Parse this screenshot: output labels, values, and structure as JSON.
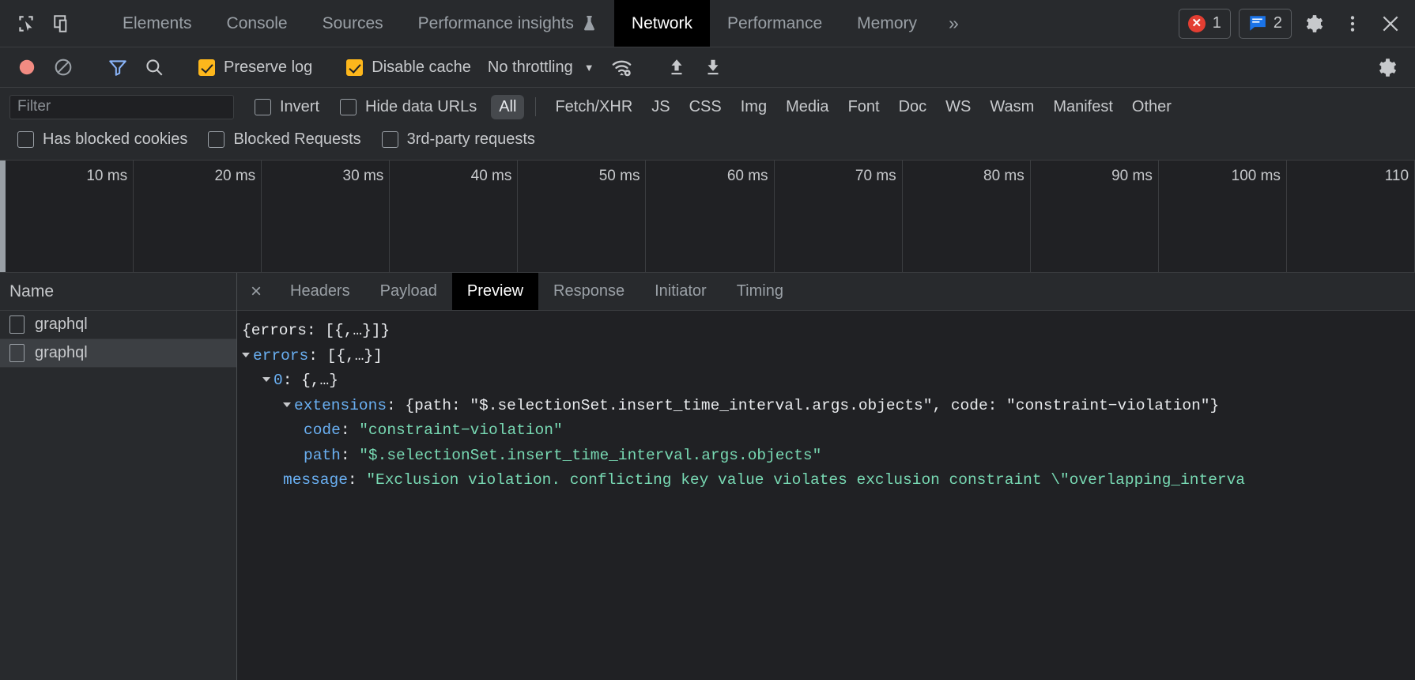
{
  "devtools": {
    "main_tabs": [
      {
        "label": "Elements",
        "selected": false
      },
      {
        "label": "Console",
        "selected": false
      },
      {
        "label": "Sources",
        "selected": false
      },
      {
        "label": "Performance insights",
        "selected": false,
        "icon": "flask-icon"
      },
      {
        "label": "Network",
        "selected": true
      },
      {
        "label": "Performance",
        "selected": false
      },
      {
        "label": "Memory",
        "selected": false
      }
    ],
    "more_tabs_label": "»",
    "error_count": "1",
    "warning_count": "2",
    "icons": {
      "inspect": "inspect-element-icon",
      "device": "device-toolbar-icon",
      "settings": "gear-icon",
      "menu": "kebab-menu-icon",
      "close": "close-icon"
    }
  },
  "network_toolbar": {
    "record_tooltip": "record-button",
    "clear_tooltip": "clear-button",
    "filter_tooltip": "filter-toggle",
    "search_tooltip": "search-button",
    "preserve_log": {
      "label": "Preserve log",
      "checked": true
    },
    "disable_cache": {
      "label": "Disable cache",
      "checked": true
    },
    "throttling": {
      "value": "No throttling",
      "caret": "▼"
    },
    "network_conditions_icon": "wifi-settings-icon",
    "export_icon": "export-har-icon",
    "import_icon": "import-har-icon",
    "settings_icon": "gear-icon"
  },
  "filter_bar": {
    "filter_placeholder": "Filter",
    "filter_value": "",
    "invert": {
      "label": "Invert",
      "checked": false
    },
    "hide_data_urls": {
      "label": "Hide data URLs",
      "checked": false
    },
    "types": [
      {
        "label": "All",
        "active": true
      },
      {
        "label": "Fetch/XHR",
        "active": false
      },
      {
        "label": "JS",
        "active": false
      },
      {
        "label": "CSS",
        "active": false
      },
      {
        "label": "Img",
        "active": false
      },
      {
        "label": "Media",
        "active": false
      },
      {
        "label": "Font",
        "active": false
      },
      {
        "label": "Doc",
        "active": false
      },
      {
        "label": "WS",
        "active": false
      },
      {
        "label": "Wasm",
        "active": false
      },
      {
        "label": "Manifest",
        "active": false
      },
      {
        "label": "Other",
        "active": false
      }
    ],
    "has_blocked_cookies": {
      "label": "Has blocked cookies",
      "checked": false
    },
    "blocked_requests": {
      "label": "Blocked Requests",
      "checked": false
    },
    "third_party_requests": {
      "label": "3rd-party requests",
      "checked": false
    }
  },
  "overview": {
    "ticks": [
      "10 ms",
      "20 ms",
      "30 ms",
      "40 ms",
      "50 ms",
      "60 ms",
      "70 ms",
      "80 ms",
      "90 ms",
      "100 ms",
      "110"
    ]
  },
  "requests": {
    "column_header": "Name",
    "rows": [
      {
        "name": "graphql",
        "selected": false
      },
      {
        "name": "graphql",
        "selected": true
      }
    ]
  },
  "detail": {
    "close_label": "×",
    "tabs": [
      {
        "label": "Headers",
        "selected": false
      },
      {
        "label": "Payload",
        "selected": false
      },
      {
        "label": "Preview",
        "selected": true
      },
      {
        "label": "Response",
        "selected": false
      },
      {
        "label": "Initiator",
        "selected": false
      },
      {
        "label": "Timing",
        "selected": false
      }
    ],
    "preview": {
      "line_root": "{errors: [{,…}]}",
      "line_errors_key": "errors",
      "line_errors_val": ": [{,…}]",
      "line_zero_key": "0",
      "line_zero_val": ": {,…}",
      "line_ext_key": "extensions",
      "line_ext_val": ": {path: \"$.selectionSet.insert_time_interval.args.objects\", code: \"constraint−violation\"}",
      "line_code_key": "code",
      "line_code_val": "\"constraint−violation\"",
      "line_path_key": "path",
      "line_path_val": "\"$.selectionSet.insert_time_interval.args.objects\"",
      "line_msg_key": "message",
      "line_msg_val": "\"Exclusion violation. conflicting key value violates exclusion constraint \\\"overlapping_interva"
    }
  }
}
